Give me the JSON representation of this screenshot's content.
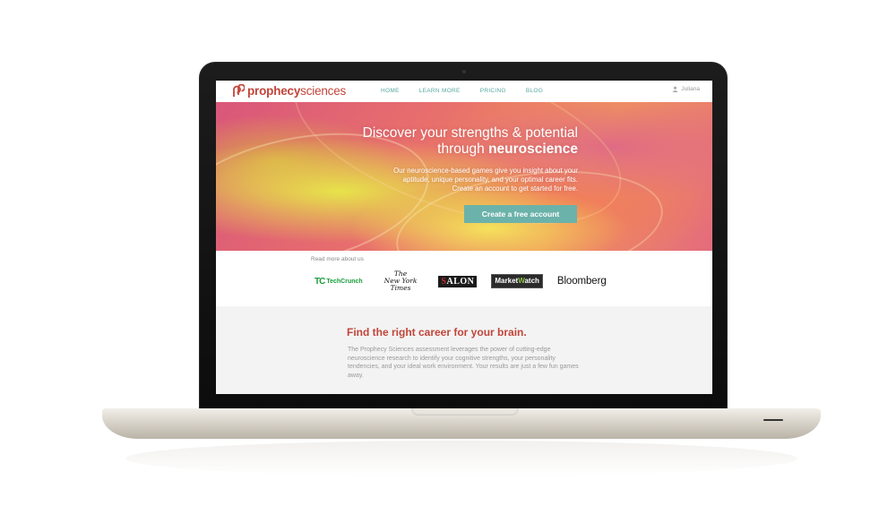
{
  "brand": {
    "name_bold": "prophecy",
    "name_light": "sciences",
    "color": "#c2453a"
  },
  "nav": {
    "items": [
      {
        "label": "HOME"
      },
      {
        "label": "LEARN MORE"
      },
      {
        "label": "PRICING"
      },
      {
        "label": "BLOG"
      }
    ],
    "color": "#56a7a0"
  },
  "user": {
    "name": "Juliana",
    "icon": "user-icon"
  },
  "hero": {
    "title_line1": "Discover your strengths & potential",
    "title_line2_prefix": "through ",
    "title_line2_strong": "neuroscience",
    "body_line1": "Our neuroscience-based games give you insight about your",
    "body_line2": "aptitude, unique personality, and your optimal career fits.",
    "body_line3": "Create an account to get started for free.",
    "cta_label": "Create a free account",
    "cta_color": "#6bb2aa"
  },
  "press": {
    "label": "Read more about us",
    "techcrunch_mark": "TC",
    "techcrunch_text": "TechCrunch",
    "nyt_line1": "The",
    "nyt_line2": "New York",
    "nyt_line3": "Times",
    "salon_s": "S",
    "salon_rest": "ALON",
    "marketwatch_a": "Market",
    "marketwatch_b": "W",
    "marketwatch_c": "atch",
    "bloomberg": "Bloomberg"
  },
  "career": {
    "title": "Find the right career for your brain.",
    "body": "The Prophecy Sciences assessment leverages the power of cutting-edge neuroscience research to identify your cognitive strengths, your personality tendencies, and your ideal work environment. Your results are just a few fun games away."
  }
}
